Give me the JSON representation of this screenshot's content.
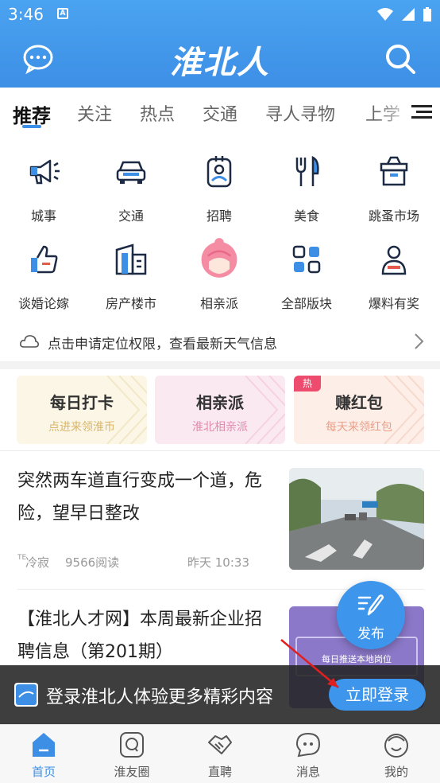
{
  "status_bar": {
    "time": "3:46"
  },
  "header": {
    "logo": "淮北人"
  },
  "tabs": [
    "推荐",
    "关注",
    "热点",
    "交通",
    "寻人寻物",
    "上学"
  ],
  "grid": [
    {
      "label": "城事",
      "icon": "megaphone-icon"
    },
    {
      "label": "交通",
      "icon": "car-icon"
    },
    {
      "label": "招聘",
      "icon": "id-badge-icon"
    },
    {
      "label": "美食",
      "icon": "fork-knife-icon"
    },
    {
      "label": "跳蚤市场",
      "icon": "box-icon"
    },
    {
      "label": "谈婚论嫁",
      "icon": "thumbs-up-icon"
    },
    {
      "label": "房产楼市",
      "icon": "building-icon"
    },
    {
      "label": "相亲派",
      "icon": "girl-avatar-icon"
    },
    {
      "label": "全部版块",
      "icon": "grid-icon"
    },
    {
      "label": "爆料有奖",
      "icon": "user-gift-icon"
    }
  ],
  "weather": {
    "text": "点击申请定位权限，查看最新天气信息"
  },
  "cards": [
    {
      "title": "每日打卡",
      "subtitle": "点进来领淮币",
      "bg": "#fbf6e6",
      "sub_color": "#d8b56a"
    },
    {
      "title": "相亲派",
      "subtitle": "淮北相亲派",
      "bg": "#fbe9f1",
      "sub_color": "#e08aae"
    },
    {
      "title": "赚红包",
      "subtitle": "每天来领红包",
      "bg": "#fdeee8",
      "sub_color": "#e9a08a",
      "badge": "热"
    }
  ],
  "news": [
    {
      "title": "突然两车道直行变成一个道，危险，望早日整改",
      "author": "冷寂",
      "author_prefix": "TE",
      "reads": "9566阅读",
      "time": "昨天 10:33"
    },
    {
      "title": "【淮北人才网】本周最新企业招聘信息（第201期）",
      "image_caption": "每日推送本地岗位"
    }
  ],
  "fab": {
    "label": "发布"
  },
  "login_banner": {
    "text": "登录淮北人体验更多精彩内容",
    "button": "立即登录"
  },
  "bottom_nav": [
    {
      "label": "首页",
      "active": true
    },
    {
      "label": "淮友圈"
    },
    {
      "label": "直聘"
    },
    {
      "label": "消息"
    },
    {
      "label": "我的"
    }
  ],
  "colors": {
    "primary": "#3d8fe6",
    "hot": "#ee4c6e"
  }
}
